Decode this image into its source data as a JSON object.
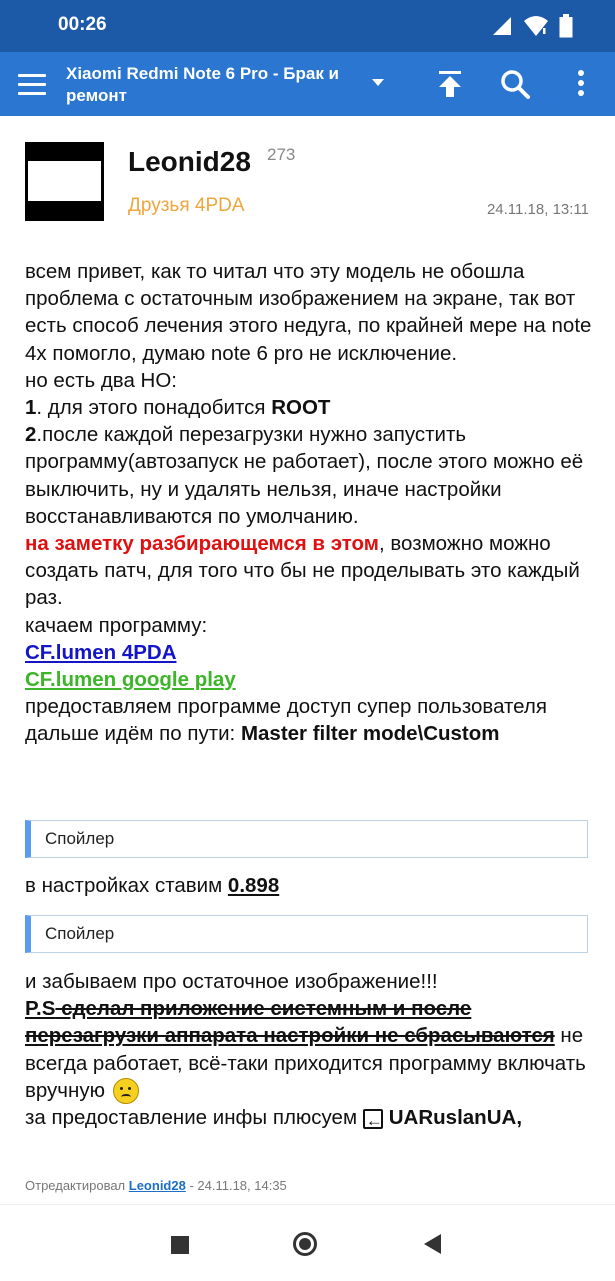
{
  "status_bar": {
    "time": "00:26"
  },
  "app_bar": {
    "title": "Xiaomi Redmi Note 6 Pro - Брак и ремонт",
    "icons": [
      "menu-icon",
      "dropdown-icon",
      "scroll-top-icon",
      "search-icon",
      "more-icon"
    ]
  },
  "post": {
    "author": "Leonid28",
    "reputation": "273",
    "group": "Друзья 4PDA",
    "date": "24.11.18, 13:11",
    "body": {
      "p1": "всем привет, как то читал что эту модель не обошла проблема с остаточным изображением на экране, так вот есть способ лечения этого недуга, по крайней мере на note 4x помогло, думаю note 6 pro не исключение.",
      "p2": "но есть два НО:",
      "item1_num": "1",
      "item1_text": ". для этого понадобится ",
      "item1_bold": "ROOT",
      "item2_num": "2",
      "item2_text": ".после каждой перезагрузки нужно запустить программу(автозапуск не работает), после этого можно её выключить, ну и удалять нельзя, иначе настройки восстанавливаются по умолчанию.",
      "note_red": "на заметку разбирающемся в этом",
      "note_rest": ", возможно можно создать патч, для того что бы не проделывать это каждый раз.",
      "download": "качаем программу:",
      "link1": "CF.lumen 4PDA",
      "link2": "CF.lumen google play",
      "access": "предоставляем программе доступ супер пользователя",
      "path_prefix": "дальше идём по пути: ",
      "path_bold": "Master filter mode\\Custom"
    },
    "spoiler1": "Спойлер",
    "settings_prefix": "в настройках ставим ",
    "settings_value": "0.898",
    "spoiler2": "Спойлер",
    "forget": "и забываем про остаточное изображение!!!",
    "ps_label": "P.S",
    "ps_strike": " сделал приложение системным и после перезагрузки аппарата настройки не сбрасываются",
    "ps_rest": " не всегда работает, всё-таки приходится программу включать вручную",
    "thanks_prefix": "за предоставление инфы плюсуем ",
    "thanks_user": "UARuslanUA,",
    "edited_prefix": "Отредактировал ",
    "edited_by": "Leonid28",
    "edited_date": " - 24.11.18, 14:35"
  }
}
